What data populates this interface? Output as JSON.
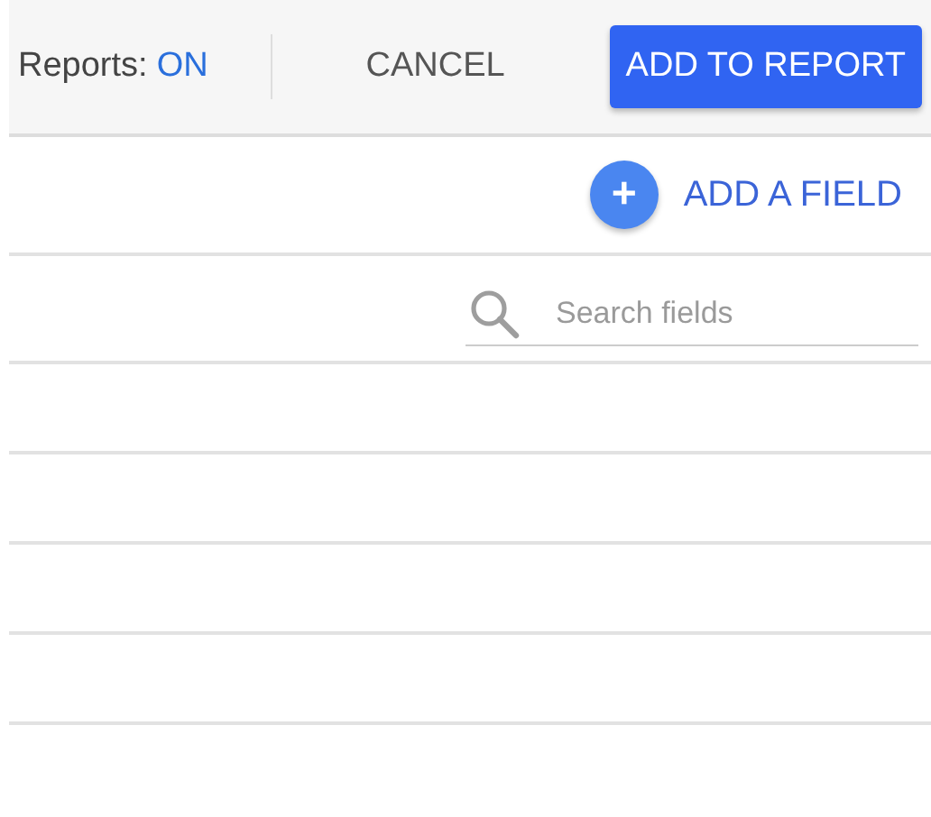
{
  "toolbar": {
    "status": {
      "label": "Reports:",
      "value": "ON",
      "on": true
    },
    "buttons": [
      {
        "label": "CANCEL",
        "kind": "text"
      },
      {
        "label": "ADD TO REPORT",
        "kind": "primary"
      }
    ]
  },
  "add_field": {
    "icon": "+",
    "label": "ADD A FIELD"
  },
  "search": {
    "placeholder": "Search fields"
  }
}
